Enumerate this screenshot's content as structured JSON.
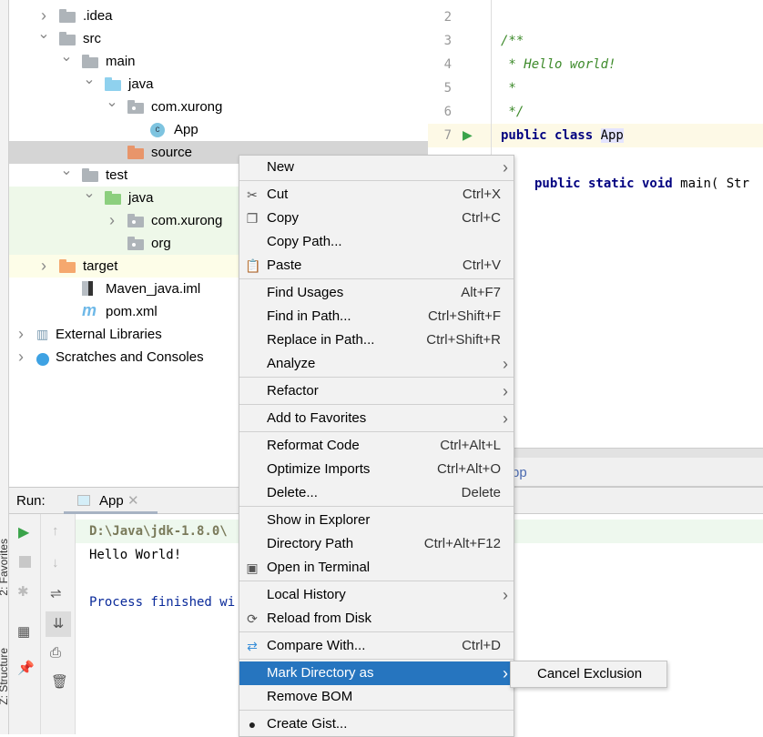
{
  "tree": [
    {
      "label": ".idea",
      "level": 1,
      "chevron": "right",
      "icon": "folder",
      "color": "#aeb4b9"
    },
    {
      "label": "src",
      "level": 1,
      "chevron": "down",
      "icon": "folder",
      "color": "#aeb4b9"
    },
    {
      "label": "main",
      "level": 2,
      "chevron": "down",
      "icon": "folder",
      "color": "#aeb4b9"
    },
    {
      "label": "java",
      "level": 3,
      "chevron": "down",
      "icon": "folder",
      "color": "#8fd1ee"
    },
    {
      "label": "com.xurong",
      "level": 4,
      "chevron": "down",
      "icon": "package",
      "color": "#aeb4b9"
    },
    {
      "label": "App",
      "level": 5,
      "chevron": "",
      "icon": "class",
      "color": "#7ec4e0"
    },
    {
      "label": "source",
      "level": 4,
      "chevron": "",
      "icon": "folder",
      "color": "#e8956a",
      "selected": true
    },
    {
      "label": "test",
      "level": 2,
      "chevron": "down",
      "icon": "folder",
      "color": "#aeb4b9"
    },
    {
      "label": "java",
      "level": 3,
      "chevron": "down",
      "icon": "folder",
      "color": "#8ccf7e",
      "bg": "#eef8e9"
    },
    {
      "label": "com.xurong",
      "level": 4,
      "chevron": "right",
      "icon": "package",
      "color": "#aeb4b9",
      "bg": "#eef8e9"
    },
    {
      "label": "org",
      "level": 4,
      "chevron": "",
      "icon": "package",
      "color": "#aeb4b9",
      "bg": "#eef8e9"
    },
    {
      "label": "target",
      "level": 1,
      "chevron": "right",
      "icon": "folder",
      "color": "#f5a86e",
      "bg": "#fdfde8"
    },
    {
      "label": "Maven_java.iml",
      "level": 2,
      "chevron": "",
      "icon": "iml-file",
      "color": "#aeb4b9"
    },
    {
      "label": "pom.xml",
      "level": 2,
      "chevron": "",
      "icon": "maven",
      "color": "#6fb9e8"
    },
    {
      "label": "External Libraries",
      "level": 0,
      "chevron": "right",
      "icon": "libraries",
      "color": "#7a9ab0"
    },
    {
      "label": "Scratches and Consoles",
      "level": 0,
      "chevron": "right",
      "icon": "scratches",
      "color": "#3ea2e3"
    }
  ],
  "editor": {
    "lines": [
      {
        "n": "2",
        "html": ""
      },
      {
        "n": "3",
        "text": "/**",
        "cls": "cm"
      },
      {
        "n": "4",
        "text": " * Hello world!",
        "cls": "cm"
      },
      {
        "n": "5",
        "text": " *",
        "cls": "cm"
      },
      {
        "n": "6",
        "text": " */",
        "cls": "cm"
      },
      {
        "n": "7",
        "kw": "public class ",
        "rest": "App",
        "current": true
      }
    ],
    "line9_kw": "public static void ",
    "line9_rest": "main( Str",
    "bottom_tab_fragment": "pp"
  },
  "run": {
    "label": "Run:",
    "tab": "App",
    "console": [
      {
        "text": "D:\\Java\\jdk-1.8.0\\",
        "color": "#7a7a5a",
        "bg": "#eef8ee",
        "bold": true
      },
      {
        "text": "Hello World!",
        "color": "#000"
      },
      {
        "text": "",
        "color": "#000"
      },
      {
        "text": "Process finished wi",
        "color": "#0a2a9a"
      }
    ],
    "side_tabs": [
      "2: Favorites",
      "Z: Structure"
    ]
  },
  "menu": [
    {
      "label": "New",
      "arrow": true
    },
    {
      "sep": true
    },
    {
      "label": "Cut",
      "shortcut": "Ctrl+X",
      "icon": "scissors-icon",
      "glyph": "✂"
    },
    {
      "label": "Copy",
      "shortcut": "Ctrl+C",
      "icon": "copy-icon",
      "glyph": "❐"
    },
    {
      "label": "Copy Path..."
    },
    {
      "label": "Paste",
      "shortcut": "Ctrl+V",
      "icon": "paste-icon",
      "glyph": "📋"
    },
    {
      "sep": true
    },
    {
      "label": "Find Usages",
      "shortcut": "Alt+F7"
    },
    {
      "label": "Find in Path...",
      "shortcut": "Ctrl+Shift+F"
    },
    {
      "label": "Replace in Path...",
      "shortcut": "Ctrl+Shift+R"
    },
    {
      "label": "Analyze",
      "arrow": true
    },
    {
      "sep": true
    },
    {
      "label": "Refactor",
      "arrow": true
    },
    {
      "sep": true
    },
    {
      "label": "Add to Favorites",
      "arrow": true
    },
    {
      "sep": true
    },
    {
      "label": "Reformat Code",
      "shortcut": "Ctrl+Alt+L"
    },
    {
      "label": "Optimize Imports",
      "shortcut": "Ctrl+Alt+O"
    },
    {
      "label": "Delete...",
      "shortcut": "Delete"
    },
    {
      "sep": true
    },
    {
      "label": "Show in Explorer"
    },
    {
      "label": "Directory Path",
      "shortcut": "Ctrl+Alt+F12"
    },
    {
      "label": "Open in Terminal",
      "icon": "terminal-icon",
      "glyph": "▣"
    },
    {
      "sep": true
    },
    {
      "label": "Local History",
      "arrow": true
    },
    {
      "label": "Reload from Disk",
      "icon": "reload-icon",
      "glyph": "⟳"
    },
    {
      "sep": true
    },
    {
      "label": "Compare With...",
      "shortcut": "Ctrl+D",
      "icon": "compare-icon",
      "glyph": "⇄"
    },
    {
      "sep": true
    },
    {
      "label": "Mark Directory as",
      "arrow": true,
      "selected": true
    },
    {
      "label": "Remove BOM"
    },
    {
      "sep": true
    },
    {
      "label": "Create Gist...",
      "icon": "github-icon",
      "glyph": "●"
    }
  ],
  "submenu": {
    "label": "Cancel Exclusion"
  },
  "colors": {
    "selection": "#2675bf",
    "tree_selected": "#d5d5d5",
    "current_line": "#fdf9e6"
  }
}
